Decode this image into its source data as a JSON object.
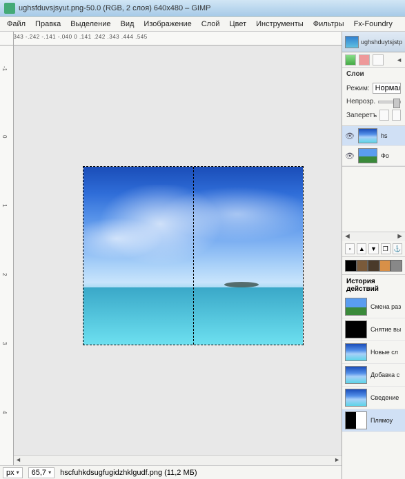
{
  "title": "ughsfduvsjsyut.png-50.0 (RGB, 2 слоя) 640x480 – GIMP",
  "menu": [
    "Файл",
    "Правка",
    "Выделение",
    "Вид",
    "Изображение",
    "Слой",
    "Цвет",
    "Инструменты",
    "Фильтры",
    "Fx-Foundry"
  ],
  "tab_file": "ughshduytsjstp",
  "layers": {
    "title": "Слои",
    "mode_label": "Режим:",
    "mode_value": "Нормальн...",
    "opacity_label": "Непрозр.",
    "lock_label": "Заперетъ",
    "items": [
      {
        "name": "hs",
        "thumb": "sky",
        "visible": true,
        "sel": true
      },
      {
        "name": "Фо",
        "thumb": "green",
        "visible": true,
        "sel": false
      }
    ]
  },
  "swatches": [
    "#000000",
    "#7a5a3a",
    "#4a3a2a",
    "#d89048",
    "#888888"
  ],
  "history": {
    "title": "История действий",
    "items": [
      {
        "label": "Смена раз",
        "thumb": "green"
      },
      {
        "label": "Снятие вы",
        "thumb": "black"
      },
      {
        "label": "Новые сл",
        "thumb": "sky"
      },
      {
        "label": "Добавка с",
        "thumb": "sky"
      },
      {
        "label": "Сведение",
        "thumb": "sky"
      },
      {
        "label": "Плямоу",
        "thumb": "bw",
        "sel": true
      }
    ]
  },
  "status": {
    "unit": "px",
    "zoom": "65,7",
    "file": "hscfuhkdsugfugidzhklgudf.png (11,2 МБ)"
  }
}
